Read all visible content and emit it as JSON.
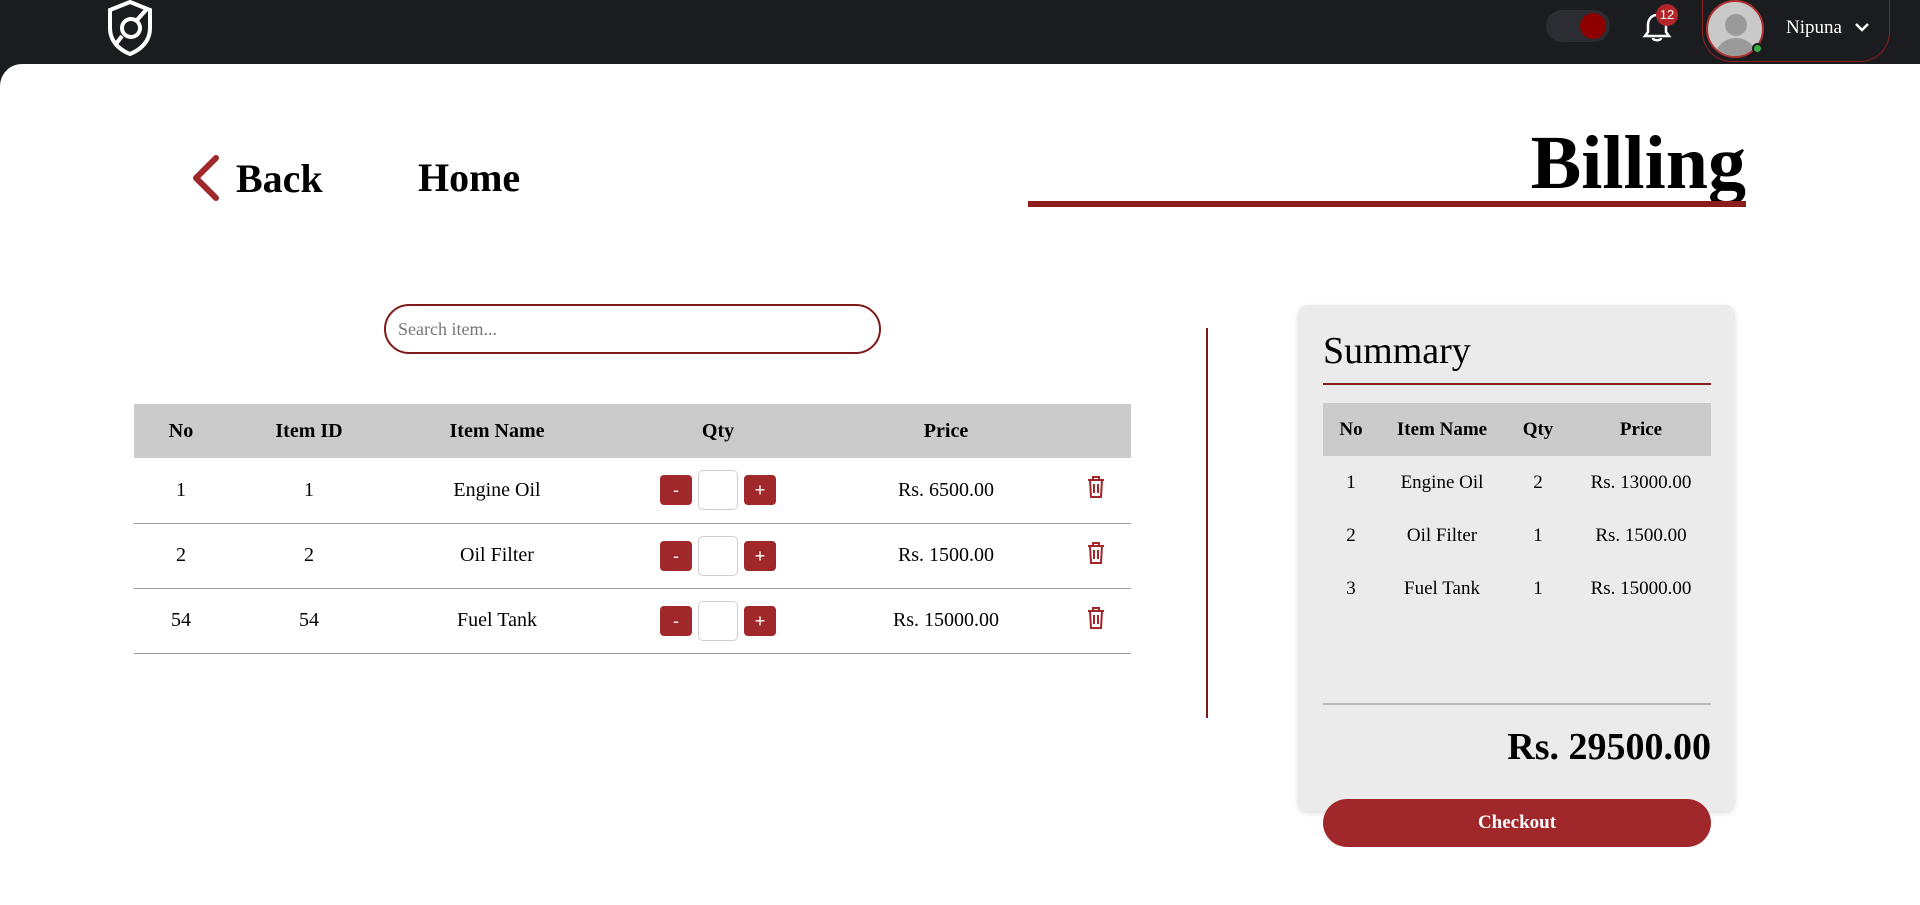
{
  "header": {
    "notification_count": "12",
    "username": "Nipuna"
  },
  "nav": {
    "back_label": "Back",
    "home_label": "Home",
    "page_title": "Billing"
  },
  "search": {
    "placeholder": "Search item...",
    "value": ""
  },
  "items_table": {
    "columns": [
      "No",
      "Item ID",
      "Item Name",
      "Qty",
      "Price"
    ],
    "rows": [
      {
        "no": "1",
        "item_id": "1",
        "item_name": "Engine Oil",
        "qty": "",
        "price": "Rs. 6500.00"
      },
      {
        "no": "2",
        "item_id": "2",
        "item_name": "Oil Filter",
        "qty": "",
        "price": "Rs. 1500.00"
      },
      {
        "no": "54",
        "item_id": "54",
        "item_name": "Fuel Tank",
        "qty": "",
        "price": "Rs. 15000.00"
      }
    ],
    "minus_label": "-",
    "plus_label": "+"
  },
  "summary": {
    "title": "Summary",
    "columns": [
      "No",
      "Item Name",
      "Qty",
      "Price"
    ],
    "rows": [
      {
        "no": "1",
        "item_name": "Engine Oil",
        "qty": "2",
        "price": "Rs. 13000.00"
      },
      {
        "no": "2",
        "item_name": "Oil Filter",
        "qty": "1",
        "price": "Rs. 1500.00"
      },
      {
        "no": "3",
        "item_name": "Fuel Tank",
        "qty": "1",
        "price": "Rs. 15000.00"
      }
    ],
    "total": "Rs. 29500.00",
    "checkout_label": "Checkout"
  },
  "colors": {
    "accent": "#a1282a",
    "topbar": "#1b1c20",
    "table_header": "#cbcbcb"
  },
  "icons": [
    "logo-icon",
    "theme-toggle",
    "bell-icon",
    "avatar",
    "chevron-down-icon",
    "back-chevron-icon",
    "trash-icon"
  ]
}
